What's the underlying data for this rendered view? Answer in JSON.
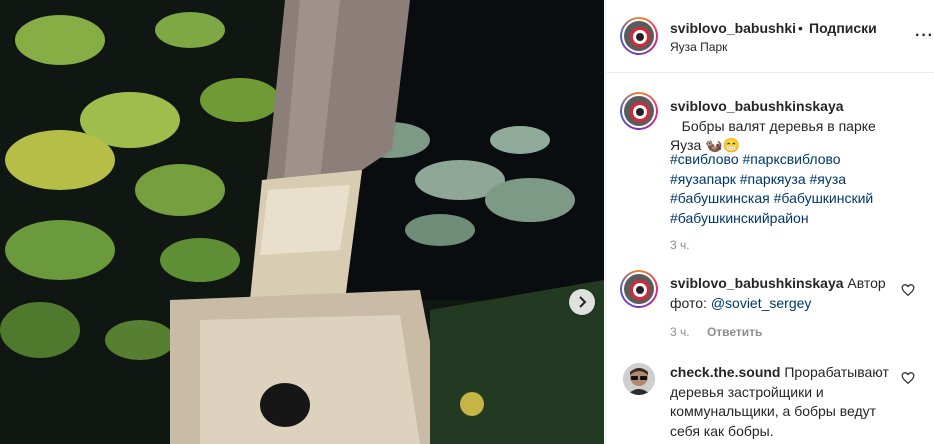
{
  "photo": {
    "alt": "",
    "next_icon": "chevron-right-icon"
  },
  "header": {
    "username": "sviblovo_babushkinskaya",
    "separator": "•",
    "follow_label": "Подписки",
    "location": "Яуза Парк",
    "more_icon": "more-horizontal-icon"
  },
  "caption": {
    "username": "sviblovo_babushkinskaya",
    "text": "Бобры валят деревья в парке Яуза 🦦😁",
    "hashtags": [
      "#свиблово",
      "#парксвиблово",
      "#яузапарк",
      "#паркяуза",
      "#яуза",
      "#бабушкинская",
      "#бабушкинский",
      "#бабушкинскийрайон"
    ],
    "time": "3 ч."
  },
  "comments": [
    {
      "username": "sviblovo_babushkinskaya",
      "text_before": "Автор фото: ",
      "mention": "@soviet_sergey",
      "time": "3 ч.",
      "reply_label": "Ответить"
    },
    {
      "username": "check.the.sound",
      "text": "Прорабатывают деревья застройщики и коммунальщики, а бобры ведут себя как бобры."
    }
  ],
  "colors": {
    "link": "#00376b",
    "muted": "#8e8e8e",
    "text": "#262626"
  }
}
